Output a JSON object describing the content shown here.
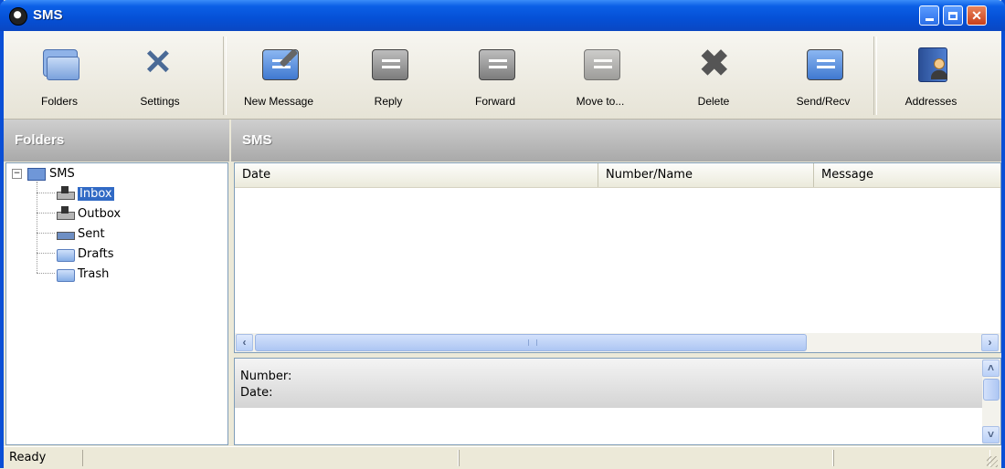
{
  "window": {
    "title": "SMS"
  },
  "toolbar": {
    "items": [
      {
        "label": "Folders",
        "icon": "folders-icon"
      },
      {
        "label": "Settings",
        "icon": "settings-icon"
      },
      {
        "label": "New Message",
        "icon": "new-message-icon"
      },
      {
        "label": "Reply",
        "icon": "reply-icon"
      },
      {
        "label": "Forward",
        "icon": "forward-icon"
      },
      {
        "label": "Move to...",
        "icon": "move-to-icon"
      },
      {
        "label": "Delete",
        "icon": "delete-icon"
      },
      {
        "label": "Send/Recv",
        "icon": "send-recv-icon"
      },
      {
        "label": "Addresses",
        "icon": "addresses-icon"
      }
    ]
  },
  "folders_panel": {
    "header": "Folders",
    "root": "SMS",
    "items": [
      {
        "label": "Inbox",
        "selected": true
      },
      {
        "label": "Outbox"
      },
      {
        "label": "Sent"
      },
      {
        "label": "Drafts"
      },
      {
        "label": "Trash"
      }
    ]
  },
  "main": {
    "header": "SMS",
    "columns": [
      "Date",
      "Number/Name",
      "Message"
    ],
    "rows": []
  },
  "details": {
    "number_label": "Number:",
    "date_label": "Date:"
  },
  "status": {
    "text": "Ready"
  },
  "colors": {
    "selection": "#316ac5",
    "titlebar": "#0550d6"
  }
}
